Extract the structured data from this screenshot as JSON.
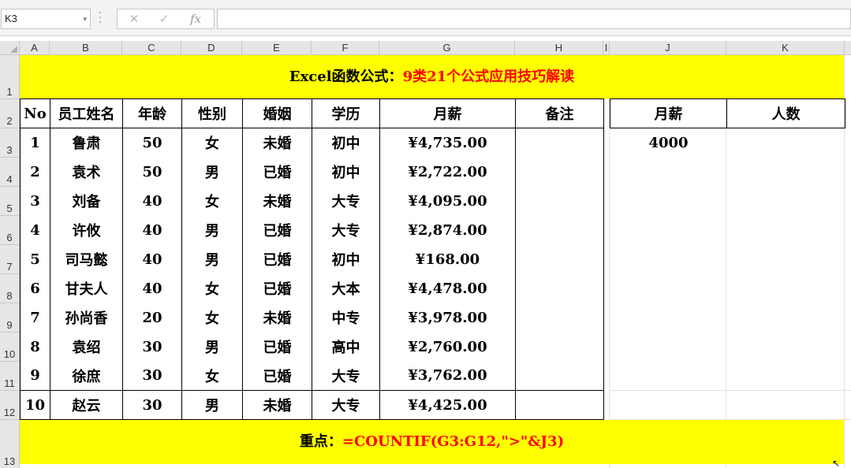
{
  "formula_bar": {
    "name_box": "K3",
    "cancel_icon": "✕",
    "enter_icon": "✓",
    "fx_label": "fx",
    "formula_value": ""
  },
  "columns": [
    "A",
    "B",
    "C",
    "D",
    "E",
    "F",
    "G",
    "H",
    "I",
    "J",
    "K"
  ],
  "rows": [
    "1",
    "2",
    "3",
    "4",
    "5",
    "6",
    "7",
    "8",
    "9",
    "10",
    "11",
    "12",
    "13"
  ],
  "title": {
    "prefix": "Excel函数公式：",
    "highlight": "9类21个公式应用技巧解读"
  },
  "table": {
    "headers": [
      "No",
      "员工姓名",
      "年龄",
      "性别",
      "婚姻",
      "学历",
      "月薪",
      "备注"
    ],
    "rows": [
      [
        "1",
        "鲁肃",
        "50",
        "女",
        "未婚",
        "初中",
        "¥4,735.00",
        ""
      ],
      [
        "2",
        "袁术",
        "50",
        "男",
        "已婚",
        "初中",
        "¥2,722.00",
        ""
      ],
      [
        "3",
        "刘备",
        "40",
        "女",
        "未婚",
        "大专",
        "¥4,095.00",
        ""
      ],
      [
        "4",
        "许攸",
        "40",
        "男",
        "已婚",
        "大专",
        "¥2,874.00",
        ""
      ],
      [
        "5",
        "司马懿",
        "40",
        "男",
        "已婚",
        "初中",
        "¥168.00",
        ""
      ],
      [
        "6",
        "甘夫人",
        "40",
        "女",
        "已婚",
        "大本",
        "¥4,478.00",
        ""
      ],
      [
        "7",
        "孙尚香",
        "20",
        "女",
        "未婚",
        "中专",
        "¥3,978.00",
        ""
      ],
      [
        "8",
        "袁绍",
        "30",
        "男",
        "已婚",
        "高中",
        "¥2,760.00",
        ""
      ],
      [
        "9",
        "徐庶",
        "30",
        "女",
        "已婚",
        "大专",
        "¥3,762.00",
        ""
      ],
      [
        "10",
        "赵云",
        "30",
        "男",
        "未婚",
        "大专",
        "¥4,425.00",
        ""
      ]
    ]
  },
  "side_table": {
    "headers": [
      "月薪",
      "人数"
    ],
    "value": "4000",
    "count": ""
  },
  "bottom": {
    "prefix": "重点：",
    "formula": "=COUNTIF(G3:G12,\">\"&J3)"
  },
  "colors": {
    "banner": "#ffff00",
    "highlight": "#ff0000",
    "header_bg": "#e6e6e6"
  }
}
